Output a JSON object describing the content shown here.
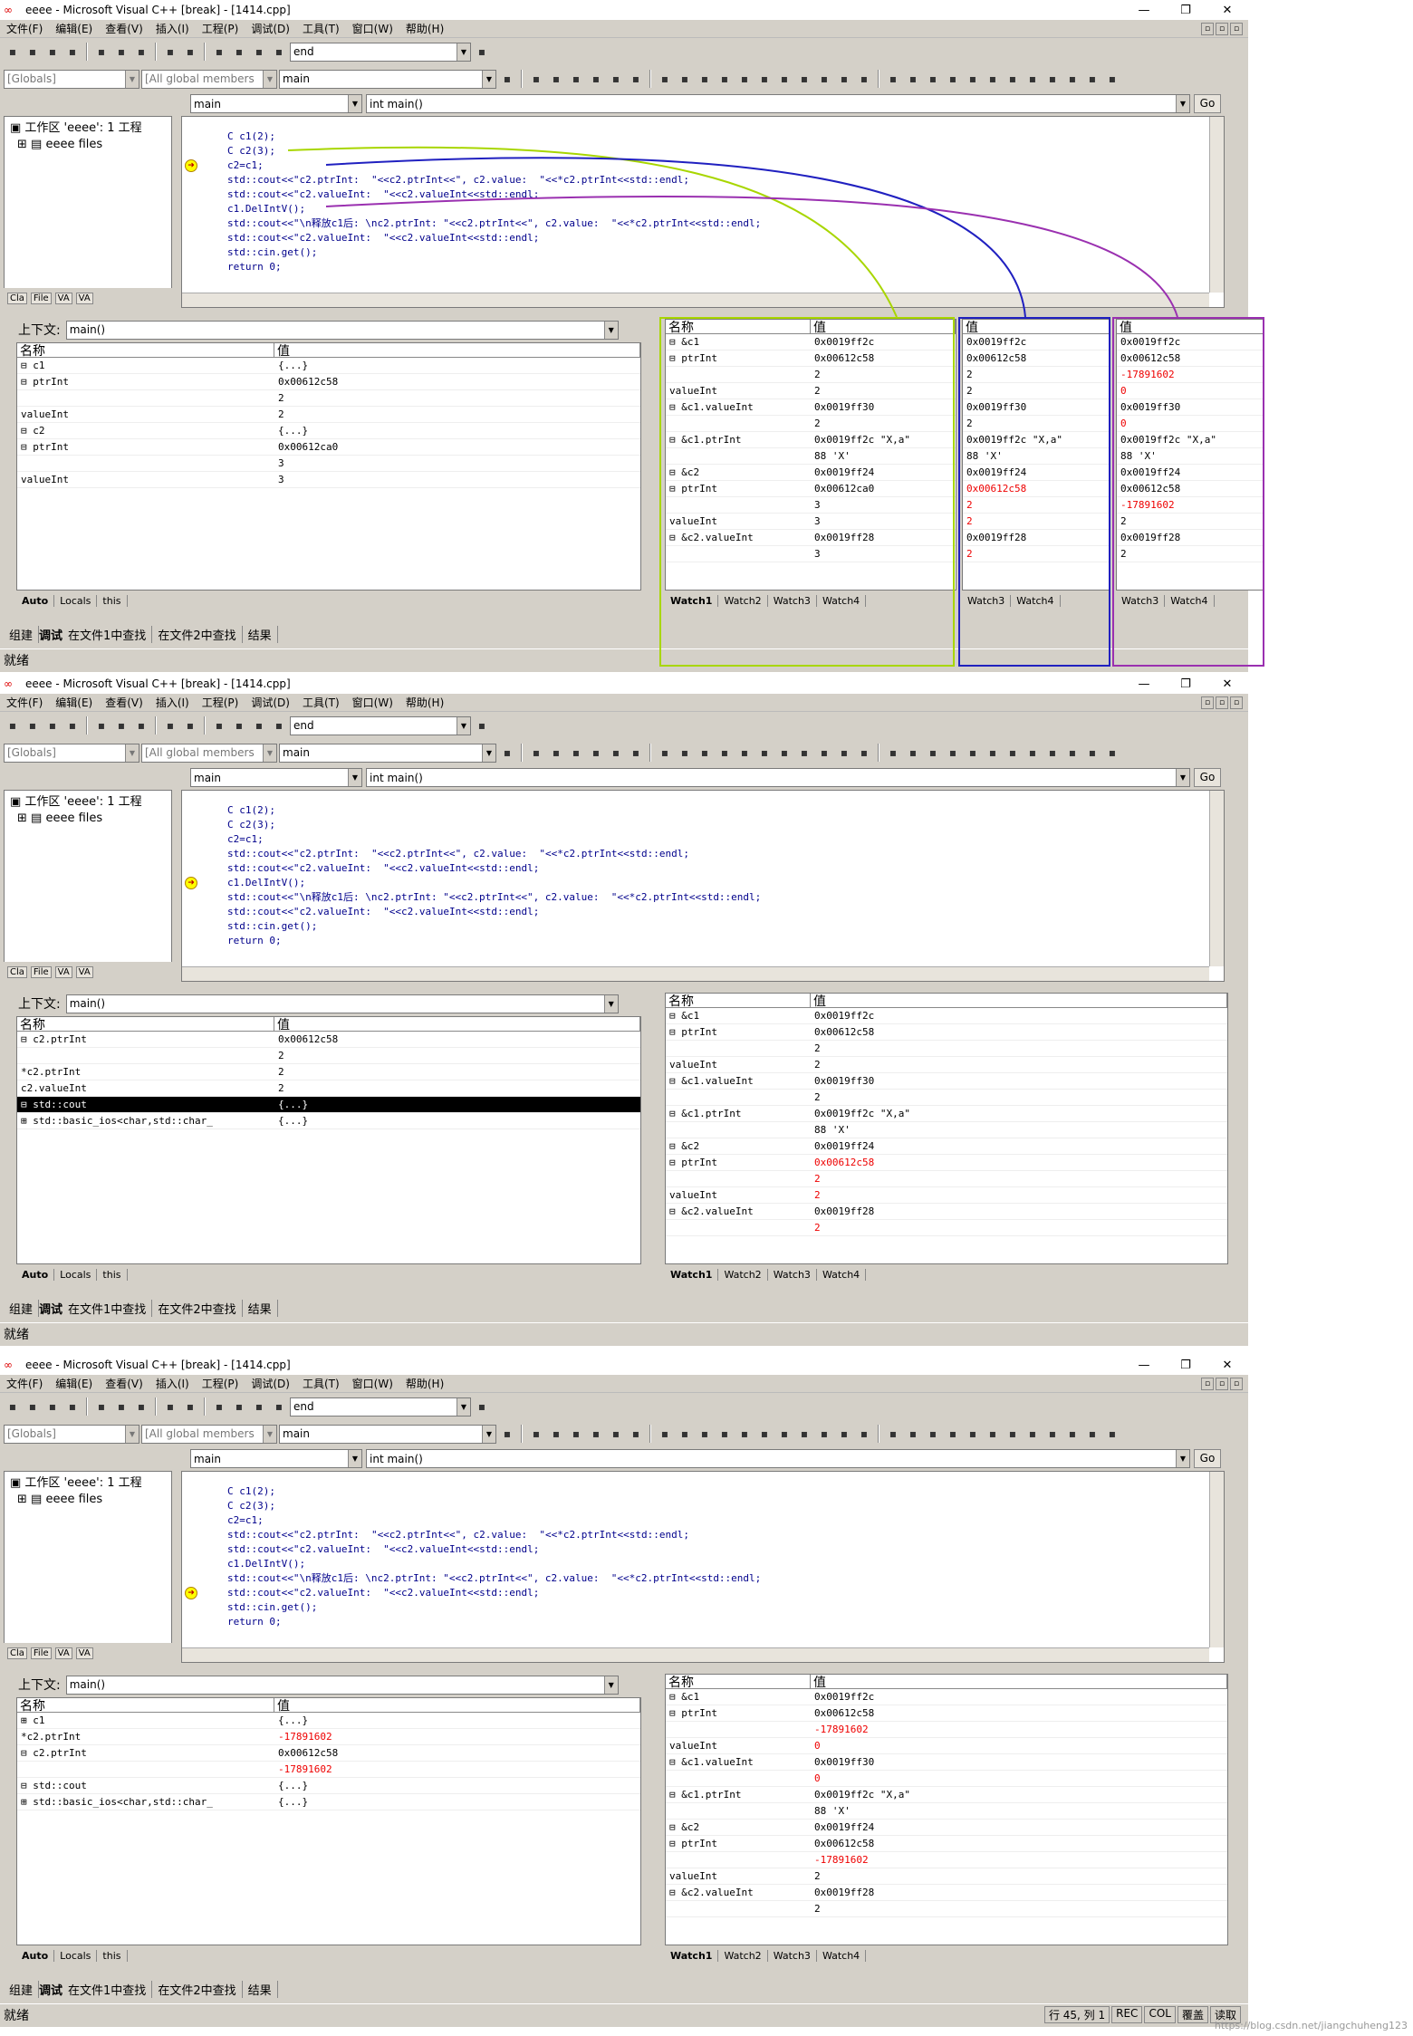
{
  "title": "eeee - Microsoft Visual C++ [break] - [1414.cpp]",
  "window_buttons": [
    "—",
    "❐",
    "✕"
  ],
  "menu": [
    "文件(F)",
    "编辑(E)",
    "查看(V)",
    "插入(I)",
    "工程(P)",
    "调试(D)",
    "工具(T)",
    "窗口(W)",
    "帮助(H)"
  ],
  "find_combo": "end",
  "globals_combo": "[Globals]",
  "members_combo": "[All global members",
  "func_combo": "main",
  "nav_scope": "main",
  "nav_func": "int main()",
  "go_label": "Go",
  "workspace": {
    "root": "工作区 'eeee': 1 工程",
    "child": "eeee files",
    "tabs": [
      "Cla",
      "File",
      "VA",
      "VA"
    ]
  },
  "code": [
    "C c1(2);",
    "C c2(3);",
    "c2=c1;",
    "std::cout<<\"c2.ptrInt:  \"<<c2.ptrInt<<\", c2.value:  \"<<*c2.ptrInt<<std::endl;",
    "std::cout<<\"c2.valueInt:  \"<<c2.valueInt<<std::endl;",
    "c1.DelIntV();",
    "",
    "std::cout<<\"\\n释放c1后: \\nc2.ptrInt: \"<<c2.ptrInt<<\", c2.value:  \"<<*c2.ptrInt<<std::endl;",
    "std::cout<<\"c2.valueInt:  \"<<c2.valueInt<<std::endl;",
    "std::cin.get();",
    "return 0;"
  ],
  "context_label": "上下文:",
  "context_value": "main()",
  "col_name": "名称",
  "col_value": "值",
  "locals_tabs": [
    "Auto",
    "Locals",
    "this"
  ],
  "watch_tabs": [
    "Watch1",
    "Watch2",
    "Watch3",
    "Watch4"
  ],
  "output_tabs": [
    "组建",
    "调试",
    "在文件1中查找",
    "在文件2中查找",
    "结果"
  ],
  "status_ready": "就绪",
  "status_pos": "行 45, 列 1",
  "status_flags": [
    "REC",
    "COL",
    "覆盖",
    "读取"
  ],
  "watermark": "https://blog.csdn.net/jiangchuheng123",
  "win1": {
    "arrow_line": 2,
    "locals": [
      [
        "⊟ c1",
        "{...}"
      ],
      [
        "  ⊟ ptrInt",
        "0x00612c58"
      ],
      [
        "",
        "2"
      ],
      [
        "    valueInt",
        "2"
      ],
      [
        "⊟ c2",
        "{...}"
      ],
      [
        "  ⊟ ptrInt",
        "0x00612ca0"
      ],
      [
        "",
        "3"
      ],
      [
        "    valueInt",
        "3"
      ]
    ],
    "watch": [
      [
        "⊟ &c1",
        "0x0019ff2c"
      ],
      [
        "  ⊟ ptrInt",
        "0x00612c58"
      ],
      [
        "",
        "2"
      ],
      [
        "    valueInt",
        "2"
      ],
      [
        "⊟ &c1.valueInt",
        "0x0019ff30"
      ],
      [
        "",
        "2"
      ],
      [
        "⊟ &c1.ptrInt",
        "0x0019ff2c \"X,a\""
      ],
      [
        "",
        "88 'X'"
      ],
      [
        "⊟ &c2",
        "0x0019ff24"
      ],
      [
        "  ⊟ ptrInt",
        "0x00612ca0"
      ],
      [
        "",
        "3"
      ],
      [
        "    valueInt",
        "3"
      ],
      [
        "⊟ &c2.valueInt",
        "0x0019ff28"
      ],
      [
        "",
        "3"
      ]
    ],
    "watch_b": [
      "0x0019ff2c",
      "0x00612c58",
      "2",
      "2",
      "0x0019ff30",
      "2",
      "0x0019ff2c \"X,a\"",
      "88 'X'",
      "0x0019ff24",
      "0x00612c58",
      "2",
      "2",
      "0x0019ff28",
      "2"
    ],
    "watch_b_red": [
      9,
      10,
      11,
      13
    ],
    "watch_c": [
      "0x0019ff2c",
      "0x00612c58",
      "-17891602",
      "0",
      "0x0019ff30",
      "0",
      "0x0019ff2c \"X,a\"",
      "88 'X'",
      "0x0019ff24",
      "0x00612c58",
      "-17891602",
      "2",
      "0x0019ff28",
      "2"
    ],
    "watch_c_red": [
      2,
      3,
      5,
      10
    ],
    "watch_b_tabs": [
      "Watch3",
      "Watch4"
    ]
  },
  "win2": {
    "arrow_line": 5,
    "locals": [
      [
        "⊟ c2.ptrInt",
        "0x00612c58"
      ],
      [
        "",
        "2"
      ],
      [
        "  *c2.ptrInt",
        "2"
      ],
      [
        "  c2.valueInt",
        "2"
      ],
      [
        "⊟ std::cout",
        "{...}"
      ],
      [
        "  ⊞ std::basic_ios<char,std::char_",
        "{...}"
      ]
    ],
    "locals_sel": 4,
    "watch": [
      [
        "⊟ &c1",
        "0x0019ff2c"
      ],
      [
        "  ⊟ ptrInt",
        "0x00612c58"
      ],
      [
        "",
        "2"
      ],
      [
        "    valueInt",
        "2"
      ],
      [
        "⊟ &c1.valueInt",
        "0x0019ff30"
      ],
      [
        "",
        "2"
      ],
      [
        "⊟ &c1.ptrInt",
        "0x0019ff2c \"X,a\""
      ],
      [
        "",
        "88 'X'"
      ],
      [
        "⊟ &c2",
        "0x0019ff24"
      ],
      [
        "  ⊟ ptrInt",
        "0x00612c58"
      ],
      [
        "",
        "2"
      ],
      [
        "    valueInt",
        "2"
      ],
      [
        "⊟ &c2.valueInt",
        "0x0019ff28"
      ],
      [
        "",
        "2"
      ]
    ],
    "watch_red": [
      9,
      10,
      11,
      13
    ]
  },
  "win3": {
    "arrow_line": 7,
    "locals": [
      [
        "⊞ c1",
        "{...}"
      ],
      [
        "  *c2.ptrInt",
        "-17891602"
      ],
      [
        "⊟ c2.ptrInt",
        "0x00612c58"
      ],
      [
        "",
        "-17891602"
      ],
      [
        "⊟ std::cout",
        "{...}"
      ],
      [
        "  ⊞ std::basic_ios<char,std::char_",
        "{...}"
      ]
    ],
    "locals_red": [
      1,
      3
    ],
    "watch": [
      [
        "⊟ &c1",
        "0x0019ff2c"
      ],
      [
        "  ⊟ ptrInt",
        "0x00612c58"
      ],
      [
        "",
        "-17891602"
      ],
      [
        "    valueInt",
        "0"
      ],
      [
        "⊟ &c1.valueInt",
        "0x0019ff30"
      ],
      [
        "",
        "0"
      ],
      [
        "⊟ &c1.ptrInt",
        "0x0019ff2c \"X,a\""
      ],
      [
        "",
        "88 'X'"
      ],
      [
        "⊟ &c2",
        "0x0019ff24"
      ],
      [
        "  ⊟ ptrInt",
        "0x00612c58"
      ],
      [
        "",
        "-17891602"
      ],
      [
        "    valueInt",
        "2"
      ],
      [
        "⊟ &c2.valueInt",
        "0x0019ff28"
      ],
      [
        "",
        "2"
      ]
    ],
    "watch_red": [
      2,
      3,
      5,
      10
    ]
  },
  "colors": {
    "green": "#a8d600",
    "blue": "#2020c0",
    "purple": "#9a30b0",
    "red": "#e00000"
  }
}
